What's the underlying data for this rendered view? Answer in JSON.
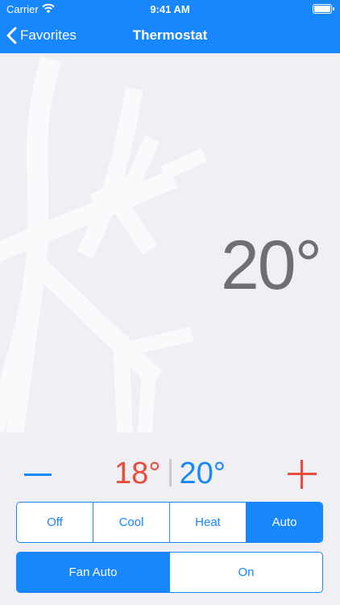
{
  "status_bar": {
    "carrier": "Carrier",
    "time": "9:41 AM"
  },
  "nav": {
    "back_label": "Favorites",
    "title": "Thermostat"
  },
  "thermostat": {
    "current_temperature": "20°",
    "heat_setpoint": "18°",
    "cool_setpoint": "20°"
  },
  "mode_control": {
    "options": [
      "Off",
      "Cool",
      "Heat",
      "Auto"
    ],
    "selected": "Auto"
  },
  "fan_control": {
    "options": [
      "Fan Auto",
      "On"
    ],
    "selected": "Fan Auto"
  },
  "colors": {
    "accent": "#1787fb",
    "heat": "#e74c3c",
    "background": "#efeff4",
    "temperature_text": "#6e6e73"
  },
  "icons": {
    "back": "chevron-left-icon",
    "decrease": "minus-icon",
    "increase": "plus-icon",
    "background": "snowflake-icon",
    "wifi": "wifi-icon",
    "battery": "battery-icon"
  }
}
